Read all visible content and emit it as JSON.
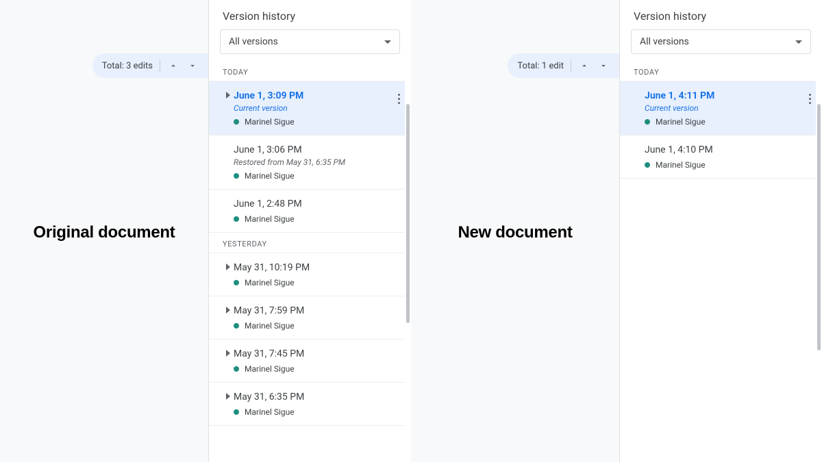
{
  "left": {
    "label": "Original document",
    "editCount": "Total: 3 edits",
    "panelTitle": "Version history",
    "dropdown": "All versions",
    "groups": [
      {
        "label": "TODAY",
        "entries": [
          {
            "title": "June 1, 3:09 PM",
            "sub": "Current version",
            "editor": "Marinel Sigue",
            "selected": true,
            "caret": true,
            "kebab": true
          },
          {
            "title": "June 1, 3:06 PM",
            "sub": "Restored from May 31, 6:35 PM",
            "editor": "Marinel Sigue",
            "selected": false,
            "caret": false,
            "kebab": false
          },
          {
            "title": "June 1, 2:48 PM",
            "sub": "",
            "editor": "Marinel Sigue",
            "selected": false,
            "caret": false,
            "kebab": false
          }
        ]
      },
      {
        "label": "YESTERDAY",
        "entries": [
          {
            "title": "May 31, 10:19 PM",
            "sub": "",
            "editor": "Marinel Sigue",
            "selected": false,
            "caret": true,
            "kebab": false
          },
          {
            "title": "May 31, 7:59 PM",
            "sub": "",
            "editor": "Marinel Sigue",
            "selected": false,
            "caret": true,
            "kebab": false
          },
          {
            "title": "May 31, 7:45 PM",
            "sub": "",
            "editor": "Marinel Sigue",
            "selected": false,
            "caret": true,
            "kebab": false
          },
          {
            "title": "May 31, 6:35 PM",
            "sub": "",
            "editor": "Marinel Sigue",
            "selected": false,
            "caret": true,
            "kebab": false
          }
        ]
      }
    ]
  },
  "right": {
    "label": "New document",
    "editCount": "Total: 1 edit",
    "panelTitle": "Version history",
    "dropdown": "All versions",
    "groups": [
      {
        "label": "TODAY",
        "entries": [
          {
            "title": "June 1, 4:11 PM",
            "sub": "Current version",
            "editor": "Marinel Sigue",
            "selected": true,
            "caret": false,
            "kebab": true
          },
          {
            "title": "June 1, 4:10 PM",
            "sub": "",
            "editor": "Marinel Sigue",
            "selected": false,
            "caret": false,
            "kebab": false
          }
        ]
      }
    ]
  }
}
